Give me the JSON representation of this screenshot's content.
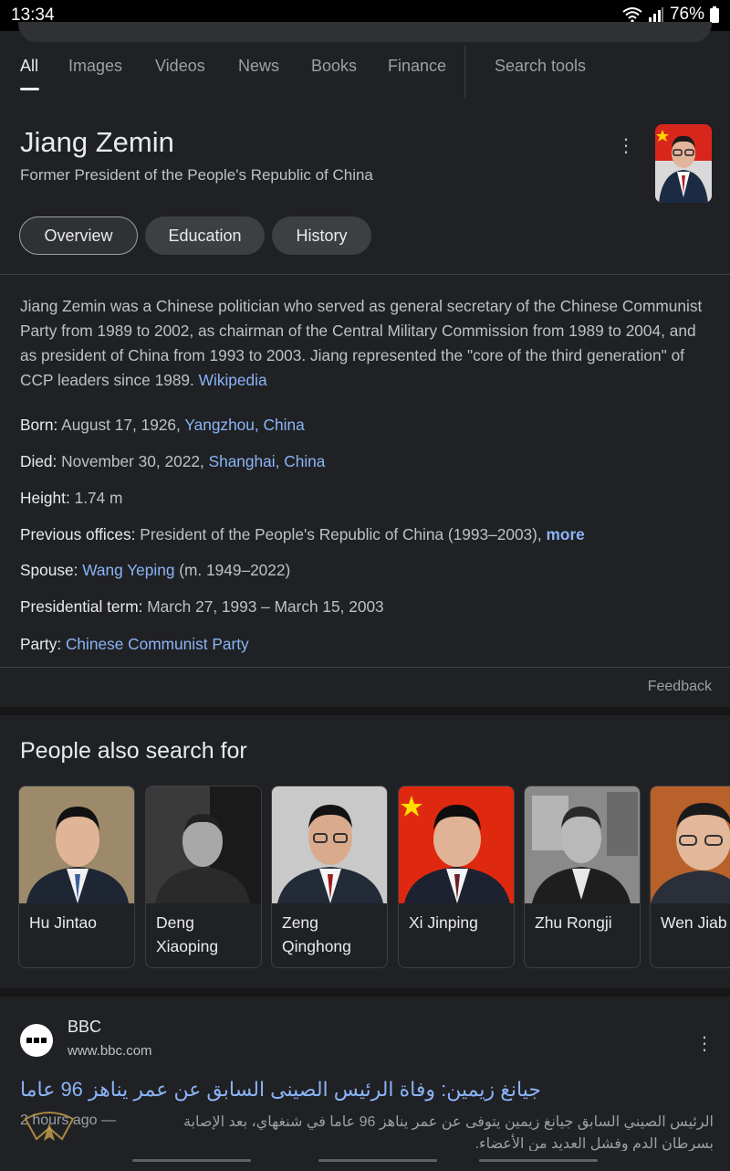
{
  "status": {
    "time": "13:34",
    "battery": "76%"
  },
  "tabs": [
    {
      "label": "All",
      "active": true
    },
    {
      "label": "Images"
    },
    {
      "label": "Videos"
    },
    {
      "label": "News"
    },
    {
      "label": "Books"
    },
    {
      "label": "Finance"
    },
    {
      "label": "Search tools"
    }
  ],
  "panel": {
    "title": "Jiang Zemin",
    "subtitle": "Former President of the People's Republic of China",
    "chips": [
      "Overview",
      "Education",
      "History"
    ],
    "description": "Jiang Zemin was a Chinese politician who served as general secretary of the Chinese Communist Party from 1989 to 2002, as chairman of the Central Military Commission from 1989 to 2004, and as president of China from 1993 to 2003. Jiang represented the \"core of the third generation\" of CCP leaders since 1989.",
    "source": "Wikipedia",
    "facts": {
      "born": {
        "label": "Born:",
        "date": "August 17, 1926,",
        "place1": "Yangzhou",
        "place2": "China"
      },
      "died": {
        "label": "Died:",
        "date": "November 30, 2022,",
        "place1": "Shanghai",
        "place2": "China"
      },
      "height": {
        "label": "Height:",
        "value": "1.74 m"
      },
      "offices": {
        "label": "Previous offices:",
        "value": "President of the People's Republic of China (1993–2003),",
        "more": "more"
      },
      "spouse": {
        "label": "Spouse:",
        "name": "Wang Yeping",
        "years": "(m. 1949–2022)"
      },
      "term": {
        "label": "Presidential term:",
        "value": "March 27, 1993 – March 15, 2003"
      },
      "party": {
        "label": "Party:",
        "value": "Chinese Communist Party"
      }
    },
    "feedback": "Feedback"
  },
  "people_also_search": {
    "title": "People also search for",
    "people": [
      {
        "name": "Hu Jintao"
      },
      {
        "name": "Deng Xiaoping"
      },
      {
        "name": "Zeng Qinghong"
      },
      {
        "name": "Xi Jinping"
      },
      {
        "name": "Zhu Rongji"
      },
      {
        "name": "Wen Jiab"
      }
    ]
  },
  "result": {
    "site": "BBC",
    "url": "www.bbc.com",
    "title": "جيانغ زيمين: وفاة الرئيس الصينى السابق عن عمر يناهز 96 عاما",
    "age": "2 hours ago —",
    "snippet1": "الرئيس الصيني السابق جيانغ زيمين يتوفى عن عمر يناهز 96 عاما في شنغهاي، بعد الإصابة",
    "snippet2": "بسرطان الدم وفشل العديد من الأعضاء."
  },
  "colors": {
    "background": "#202124",
    "link": "#8ab4f8",
    "chinese_flag_red": "#de2910"
  }
}
